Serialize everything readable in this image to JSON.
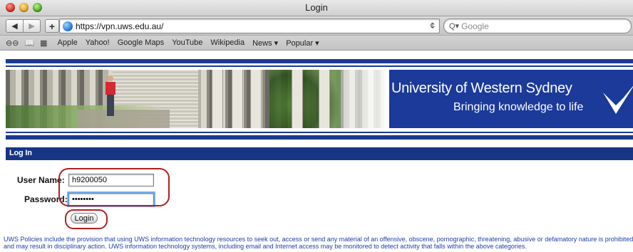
{
  "window": {
    "title": "Login"
  },
  "toolbar": {
    "back_label": "◀",
    "forward_label": "▶",
    "add_label": "+",
    "url": "https://vpn.uws.edu.au/",
    "reload_label": "¢",
    "search_icon": "Q▾",
    "search_placeholder": "Google"
  },
  "bookmarks": {
    "icons": [
      "reading-glasses-icon",
      "book-icon",
      "grid-icon"
    ],
    "items": [
      "Apple",
      "Yahoo!",
      "Google Maps",
      "YouTube",
      "Wikipedia",
      "News ▾",
      "Popular ▾"
    ]
  },
  "banner": {
    "name": "University of Western Sydney",
    "tagline": "Bringing knowledge to life"
  },
  "login": {
    "section_title": "Log In",
    "username_label": "User Name:",
    "username_value": "h9200050",
    "password_label": "Password:",
    "password_value": "••••••••",
    "button_label": "Login"
  },
  "policy": {
    "text": "UWS Policies include the provision that using UWS information technology resources to seek out, access or send any material of an offensive, obscene, pornographic, threatening, abusive or defamatory nature is prohibited and may result in disciplinary action. UWS information technology systems, including email and Internet access may be monitored to detect activity that falls within the above categories."
  },
  "colors": {
    "brand_blue": "#1b3a9a",
    "annotation_red": "#b21f1f",
    "policy_text": "#1f3fa5"
  }
}
